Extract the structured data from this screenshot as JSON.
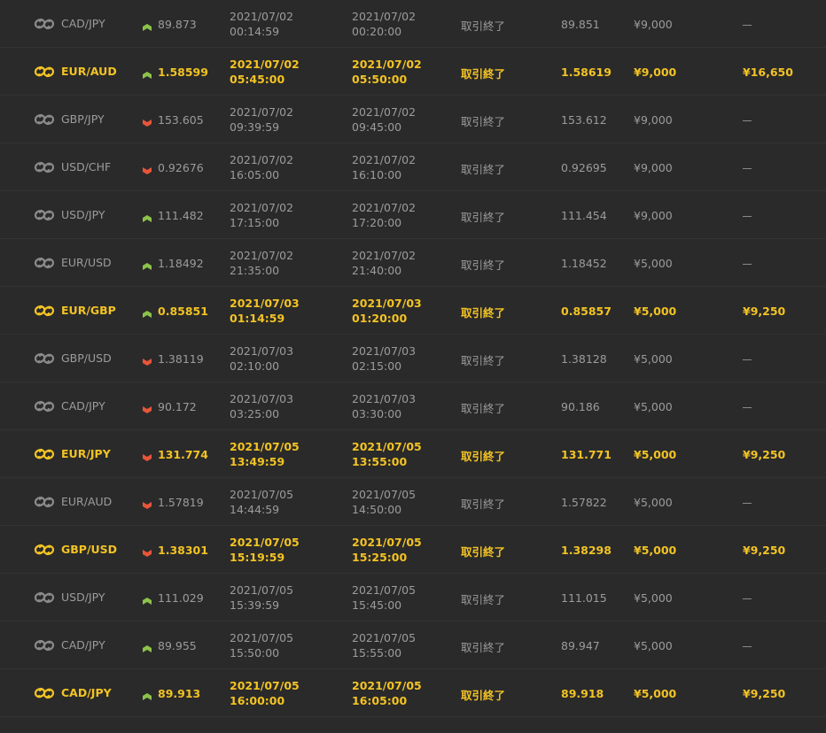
{
  "colors": {
    "background": "#2a2a2a",
    "normal_text": "#9c9c9c",
    "win_text": "#f3c324",
    "up_arrow": "#8bc34a",
    "down_arrow": "#e8553a"
  },
  "icons": {
    "pair": "exchange-link-icon",
    "up": "arrow-up-icon",
    "down": "arrow-down-icon"
  },
  "rows": [
    {
      "pair": "CAD/JPY",
      "dir": "up",
      "entry": "89.873",
      "start_date": "2021/07/02",
      "start_time": "00:14:59",
      "end_date": "2021/07/02",
      "end_time": "00:20:00",
      "status": "取引終了",
      "close": "89.851",
      "amount": "¥9,000",
      "payout": "",
      "win": false
    },
    {
      "pair": "EUR/AUD",
      "dir": "up",
      "entry": "1.58599",
      "start_date": "2021/07/02",
      "start_time": "05:45:00",
      "end_date": "2021/07/02",
      "end_time": "05:50:00",
      "status": "取引終了",
      "close": "1.58619",
      "amount": "¥9,000",
      "payout": "¥16,650",
      "win": true
    },
    {
      "pair": "GBP/JPY",
      "dir": "down",
      "entry": "153.605",
      "start_date": "2021/07/02",
      "start_time": "09:39:59",
      "end_date": "2021/07/02",
      "end_time": "09:45:00",
      "status": "取引終了",
      "close": "153.612",
      "amount": "¥9,000",
      "payout": "",
      "win": false
    },
    {
      "pair": "USD/CHF",
      "dir": "down",
      "entry": "0.92676",
      "start_date": "2021/07/02",
      "start_time": "16:05:00",
      "end_date": "2021/07/02",
      "end_time": "16:10:00",
      "status": "取引終了",
      "close": "0.92695",
      "amount": "¥9,000",
      "payout": "",
      "win": false
    },
    {
      "pair": "USD/JPY",
      "dir": "up",
      "entry": "111.482",
      "start_date": "2021/07/02",
      "start_time": "17:15:00",
      "end_date": "2021/07/02",
      "end_time": "17:20:00",
      "status": "取引終了",
      "close": "111.454",
      "amount": "¥9,000",
      "payout": "",
      "win": false
    },
    {
      "pair": "EUR/USD",
      "dir": "up",
      "entry": "1.18492",
      "start_date": "2021/07/02",
      "start_time": "21:35:00",
      "end_date": "2021/07/02",
      "end_time": "21:40:00",
      "status": "取引終了",
      "close": "1.18452",
      "amount": "¥5,000",
      "payout": "",
      "win": false
    },
    {
      "pair": "EUR/GBP",
      "dir": "up",
      "entry": "0.85851",
      "start_date": "2021/07/03",
      "start_time": "01:14:59",
      "end_date": "2021/07/03",
      "end_time": "01:20:00",
      "status": "取引終了",
      "close": "0.85857",
      "amount": "¥5,000",
      "payout": "¥9,250",
      "win": true
    },
    {
      "pair": "GBP/USD",
      "dir": "down",
      "entry": "1.38119",
      "start_date": "2021/07/03",
      "start_time": "02:10:00",
      "end_date": "2021/07/03",
      "end_time": "02:15:00",
      "status": "取引終了",
      "close": "1.38128",
      "amount": "¥5,000",
      "payout": "",
      "win": false
    },
    {
      "pair": "CAD/JPY",
      "dir": "down",
      "entry": "90.172",
      "start_date": "2021/07/03",
      "start_time": "03:25:00",
      "end_date": "2021/07/03",
      "end_time": "03:30:00",
      "status": "取引終了",
      "close": "90.186",
      "amount": "¥5,000",
      "payout": "",
      "win": false
    },
    {
      "pair": "EUR/JPY",
      "dir": "down",
      "entry": "131.774",
      "start_date": "2021/07/05",
      "start_time": "13:49:59",
      "end_date": "2021/07/05",
      "end_time": "13:55:00",
      "status": "取引終了",
      "close": "131.771",
      "amount": "¥5,000",
      "payout": "¥9,250",
      "win": true
    },
    {
      "pair": "EUR/AUD",
      "dir": "down",
      "entry": "1.57819",
      "start_date": "2021/07/05",
      "start_time": "14:44:59",
      "end_date": "2021/07/05",
      "end_time": "14:50:00",
      "status": "取引終了",
      "close": "1.57822",
      "amount": "¥5,000",
      "payout": "",
      "win": false
    },
    {
      "pair": "GBP/USD",
      "dir": "down",
      "entry": "1.38301",
      "start_date": "2021/07/05",
      "start_time": "15:19:59",
      "end_date": "2021/07/05",
      "end_time": "15:25:00",
      "status": "取引終了",
      "close": "1.38298",
      "amount": "¥5,000",
      "payout": "¥9,250",
      "win": true
    },
    {
      "pair": "USD/JPY",
      "dir": "up",
      "entry": "111.029",
      "start_date": "2021/07/05",
      "start_time": "15:39:59",
      "end_date": "2021/07/05",
      "end_time": "15:45:00",
      "status": "取引終了",
      "close": "111.015",
      "amount": "¥5,000",
      "payout": "",
      "win": false
    },
    {
      "pair": "CAD/JPY",
      "dir": "up",
      "entry": "89.955",
      "start_date": "2021/07/05",
      "start_time": "15:50:00",
      "end_date": "2021/07/05",
      "end_time": "15:55:00",
      "status": "取引終了",
      "close": "89.947",
      "amount": "¥5,000",
      "payout": "",
      "win": false
    },
    {
      "pair": "CAD/JPY",
      "dir": "up",
      "entry": "89.913",
      "start_date": "2021/07/05",
      "start_time": "16:00:00",
      "end_date": "2021/07/05",
      "end_time": "16:05:00",
      "status": "取引終了",
      "close": "89.918",
      "amount": "¥5,000",
      "payout": "¥9,250",
      "win": true
    }
  ]
}
